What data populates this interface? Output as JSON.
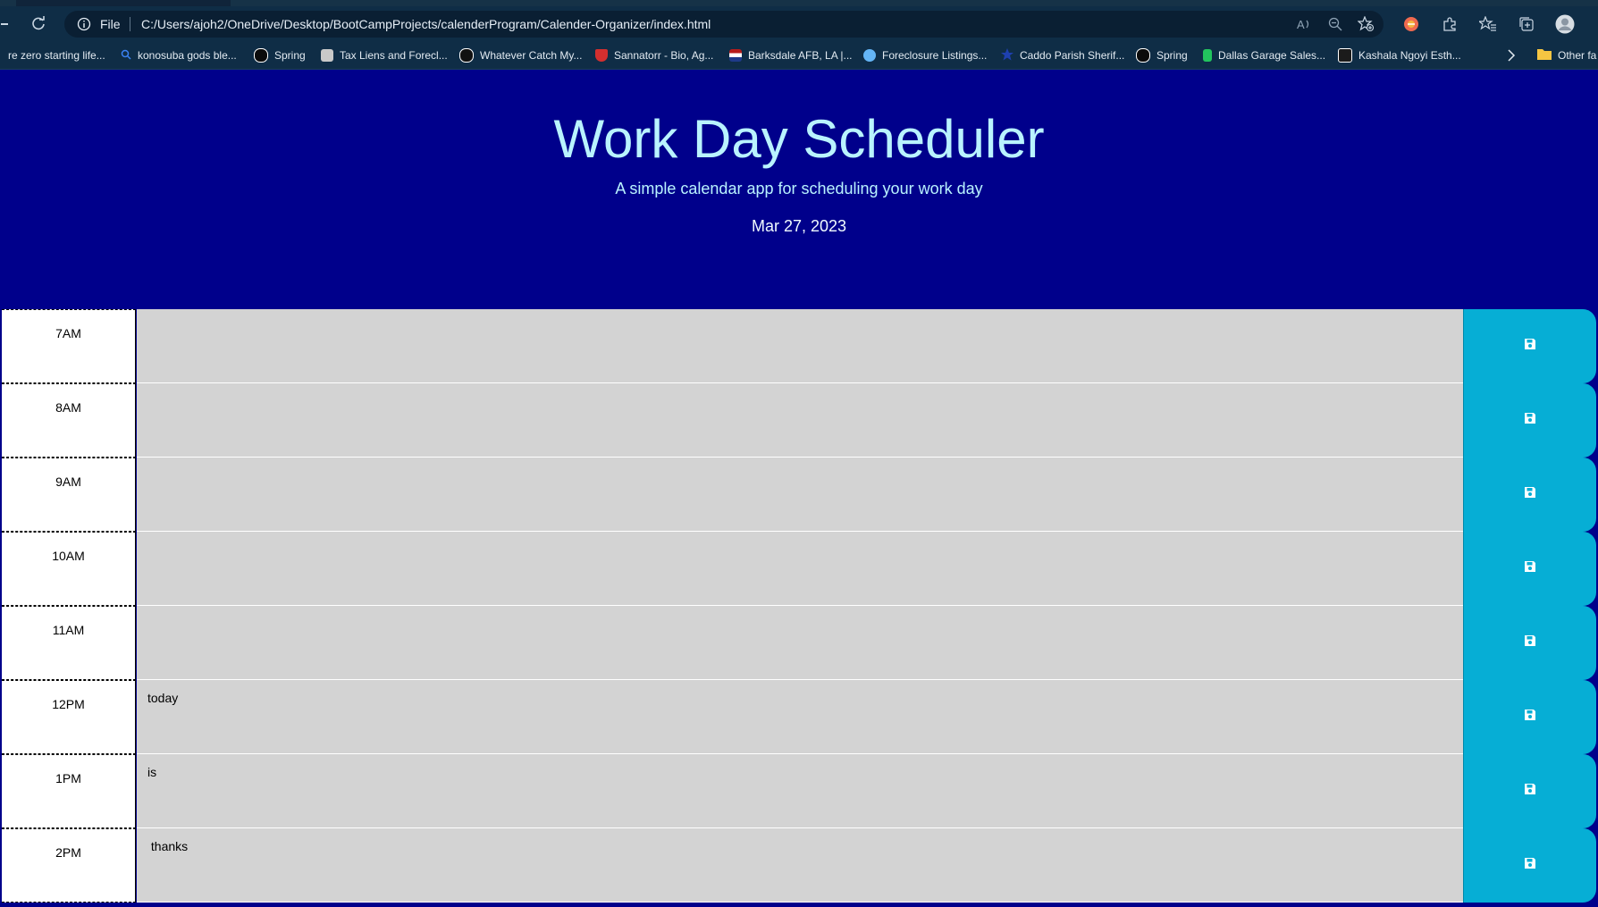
{
  "browser": {
    "address_scheme": "File",
    "url": "C:/Users/ajoh2/OneDrive/Desktop/BootCampProjects/calenderProgram/Calender-Organizer/index.html"
  },
  "bookmarks": [
    {
      "label": "re zero starting life...",
      "color": ""
    },
    {
      "label": "konosuba gods ble...",
      "color": "#3b82f6"
    },
    {
      "label": "Spring",
      "color": "#ffffff"
    },
    {
      "label": "Tax Liens and Forecl...",
      "color": "#c9c9c9"
    },
    {
      "label": "Whatever Catch My...",
      "color": "#ffffff"
    },
    {
      "label": "Sannatorr - Bio, Ag...",
      "color": "#d32f2f"
    },
    {
      "label": "Barksdale AFB, LA |...",
      "color": "#b71c1c"
    },
    {
      "label": "Foreclosure Listings...",
      "color": "#64b5f6"
    },
    {
      "label": "Caddo Parish Sherif...",
      "color": "#1e40af"
    },
    {
      "label": "Spring",
      "color": "#ffffff"
    },
    {
      "label": "Dallas Garage Sales...",
      "color": "#22c55e"
    },
    {
      "label": "Kashala Ngoyi Esth...",
      "color": "#ffffff"
    },
    {
      "label": "Other fa",
      "color": "#f5c542"
    }
  ],
  "header": {
    "title": "Work Day Scheduler",
    "lead": "A simple calendar app for scheduling your work day",
    "date": "Mar 27, 2023"
  },
  "schedule": [
    {
      "hour": "7AM",
      "text": ""
    },
    {
      "hour": "8AM",
      "text": ""
    },
    {
      "hour": "9AM",
      "text": ""
    },
    {
      "hour": "10AM",
      "text": ""
    },
    {
      "hour": "11AM",
      "text": ""
    },
    {
      "hour": "12PM",
      "text": "today"
    },
    {
      "hour": "1PM",
      "text": "is"
    },
    {
      "hour": "2PM",
      "text": " thanks"
    }
  ],
  "colors": {
    "page_bg": "#00008b",
    "heading": "#b9f3ff",
    "hour_bg": "#ffffff",
    "row_bg": "#d3d3d3",
    "save_bg": "#06aed5"
  },
  "icons": {
    "save": "floppy-disk-icon"
  }
}
